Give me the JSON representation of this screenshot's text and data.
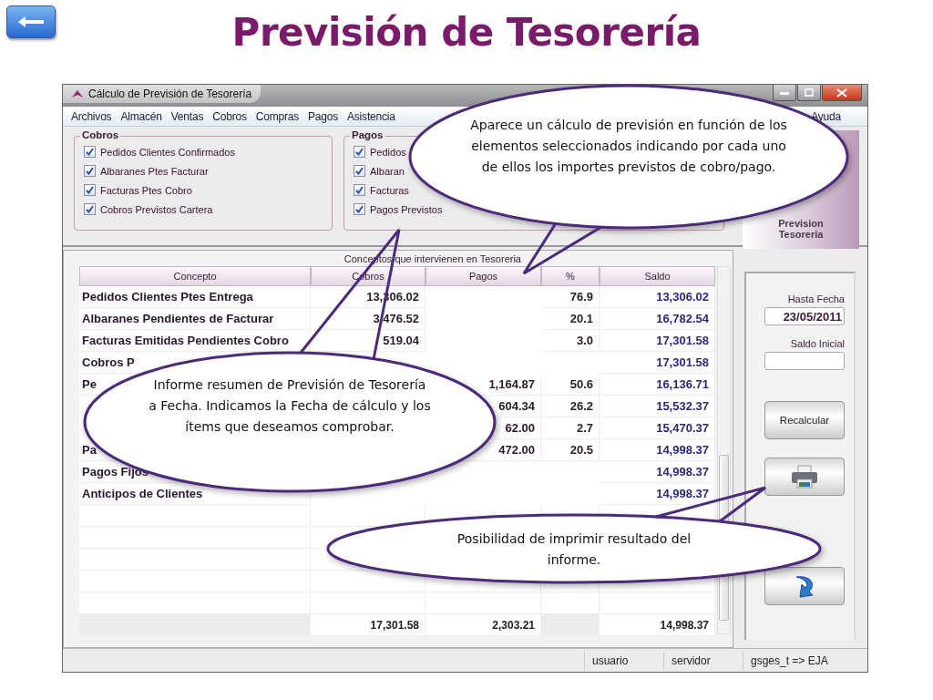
{
  "slide_title": "Previsión de Tesorería",
  "window": {
    "title": "Cálculo de Previsión de Tesorería"
  },
  "menu": [
    "Archivos",
    "Almacén",
    "Ventas",
    "Cobros",
    "Compras",
    "Pagos",
    "Asistencia",
    "Ayuda"
  ],
  "cobros_group": {
    "title": "Cobros",
    "items": [
      {
        "label": "Pedidos Clientes Confirmados",
        "checked": true
      },
      {
        "label": "Albaranes Ptes Facturar",
        "checked": true
      },
      {
        "label": "Facturas Ptes Cobro",
        "checked": true
      },
      {
        "label": "Cobros Previstos Cartera",
        "checked": true
      }
    ]
  },
  "pagos_group": {
    "title": "Pagos",
    "items": [
      {
        "label": "Pedidos",
        "checked": true
      },
      {
        "label": "Albaran",
        "checked": true
      },
      {
        "label": "Facturas",
        "checked": true
      },
      {
        "label": "Pagos Previstos",
        "checked": true
      }
    ]
  },
  "logo_panel": {
    "caption": "Prevision Tesoreria"
  },
  "table": {
    "title": "Conceptos que intervienen en Tesoreria",
    "columns": [
      "Concepto",
      "Cobros",
      "Pagos",
      "%",
      "Saldo"
    ],
    "rows": [
      {
        "concept": "Pedidos Clientes Ptes Entrega",
        "cobros": "13,306.02",
        "percent": "76.9",
        "saldo": "13,306.02"
      },
      {
        "concept": "Albaranes Pendientes de Facturar",
        "cobros": "3,476.52",
        "percent": "20.1",
        "saldo": "16,782.54"
      },
      {
        "concept": "Facturas Emitidas Pendientes Cobro",
        "cobros": "519.04",
        "percent": "3.0",
        "saldo": "17,301.58"
      },
      {
        "concept": "Cobros P",
        "saldo": "17,301.58"
      },
      {
        "concept": "Pe",
        "pagos": "1,164.87",
        "percent": "50.6",
        "saldo": "16,136.71"
      },
      {
        "pagos": "604.34",
        "percent": "26.2",
        "saldo": "15,532.37"
      },
      {
        "pagos": "62.00",
        "percent": "2.7",
        "saldo": "15,470.37"
      },
      {
        "concept": "Pa",
        "pagos": "472.00",
        "percent": "20.5",
        "saldo": "14,998.37"
      },
      {
        "concept": "Pagos Fijos",
        "saldo": "14,998.37"
      },
      {
        "concept": "Anticipos de Clientes",
        "saldo": "14,998.37"
      }
    ],
    "totals": {
      "cobros": "17,301.58",
      "pagos": "2,303.21",
      "saldo": "14,998.37"
    }
  },
  "side_panel": {
    "date_label": "Hasta Fecha",
    "date_value": "23/05/2011",
    "balance_label": "Saldo Inicial",
    "recalc_button": "Recalcular"
  },
  "status_bar": [
    "usuario",
    "servidor",
    "gsges_t => EJA"
  ],
  "callouts": [
    "Aparece un cálculo de previsión en función de los elementos seleccionados indicando por cada uno de ellos los importes previstos de cobro/pago.",
    "Informe resumen de Previsión de Tesorería a Fecha. Indicamos la Fecha de cálculo y los ítems que deseamos comprobar.",
    "Posibilidad de imprimir resultado del informe."
  ]
}
